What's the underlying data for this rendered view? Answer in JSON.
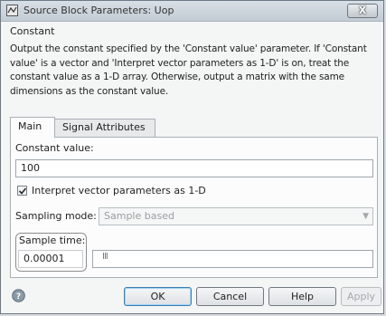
{
  "window": {
    "title": "Source Block Parameters: Uop",
    "close_label": "X"
  },
  "block": {
    "type_label": "Constant",
    "description": "Output the constant specified by the 'Constant value' parameter. If 'Constant value' is a vector and 'Interpret vector parameters as 1-D' is on, treat the constant value as a 1-D array. Otherwise, output a matrix with the same dimensions as the constant value."
  },
  "tabs": [
    {
      "label": "Main",
      "selected": true
    },
    {
      "label": "Signal Attributes",
      "selected": false
    }
  ],
  "main": {
    "constant_value_label": "Constant value:",
    "constant_value": "100",
    "interpret_vector_label": "Interpret vector parameters as 1-D",
    "interpret_vector_checked": true,
    "sampling_mode_label": "Sampling mode:",
    "sampling_mode_value": "Sample based",
    "sample_time_label": "Sample time:",
    "sample_time_value": "0.00001",
    "cursor_text": "III"
  },
  "buttons": {
    "ok": "OK",
    "cancel": "Cancel",
    "help": "Help",
    "apply": "Apply"
  },
  "icons": {
    "title": "simulink-block-icon",
    "help": "help-icon",
    "close": "close-icon",
    "dropdown": "chevron-down-icon",
    "check": "checkmark-icon"
  },
  "colors": {
    "accent": "#3c7fb1",
    "panel_bg": "#fcfcfc",
    "dialog_bg": "#f4f5f5"
  }
}
